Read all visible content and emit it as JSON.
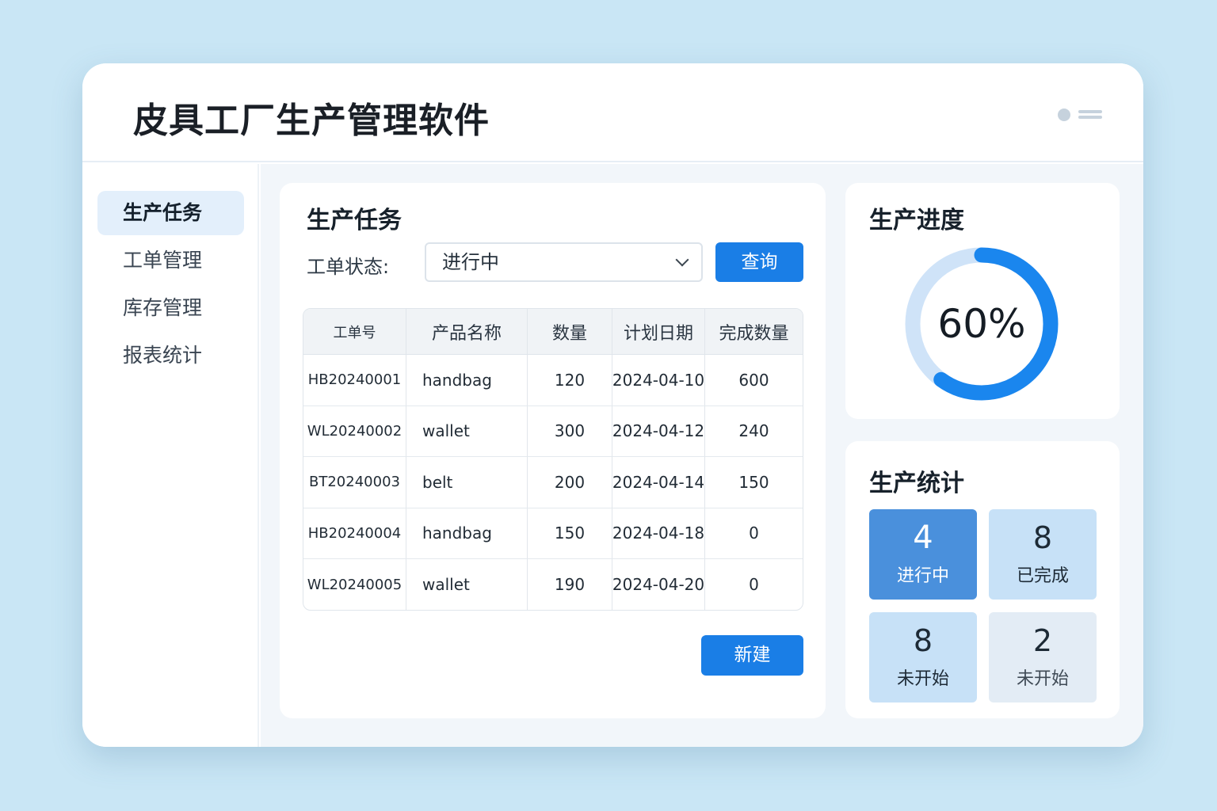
{
  "app": {
    "title": "皮具工厂生产管理软件"
  },
  "sidebar": {
    "items": [
      {
        "label": "生产任务",
        "active": true
      },
      {
        "label": "工单管理",
        "active": false
      },
      {
        "label": "库存管理",
        "active": false
      },
      {
        "label": "报表统计",
        "active": false
      }
    ]
  },
  "task_panel": {
    "title": "生产任务",
    "filter_label": "工单状态:",
    "filter_value": "进行中",
    "query_label": "查询",
    "new_label": "新建",
    "table": {
      "headers": [
        "工单号",
        "产品名称",
        "数量",
        "计划日期",
        "完成数量"
      ],
      "rows": [
        [
          "HB20240001",
          "handbag",
          "120",
          "2024-04-10",
          "600"
        ],
        [
          "WL20240002",
          "wallet",
          "300",
          "2024-04-12",
          "240"
        ],
        [
          "BT20240003",
          "belt",
          "200",
          "2024-04-14",
          "150"
        ],
        [
          "HB20240004",
          "handbag",
          "150",
          "2024-04-18",
          "0"
        ],
        [
          "WL20240005",
          "wallet",
          "190",
          "2024-04-20",
          "0"
        ]
      ]
    }
  },
  "progress_panel": {
    "title": "生产进度",
    "percent": 60,
    "percent_label": "60%"
  },
  "stats_panel": {
    "title": "生产统计",
    "tiles": [
      {
        "value": "4",
        "label": "进行中"
      },
      {
        "value": "8",
        "label": "已完成"
      },
      {
        "value": "8",
        "label": "未开始"
      },
      {
        "value": "2",
        "label": "未开始"
      }
    ]
  },
  "colors": {
    "accent": "#1a7ee6",
    "donut_track": "#cfe3f8",
    "donut_fill": "#1a86ee",
    "background": "#c9e6f5"
  }
}
